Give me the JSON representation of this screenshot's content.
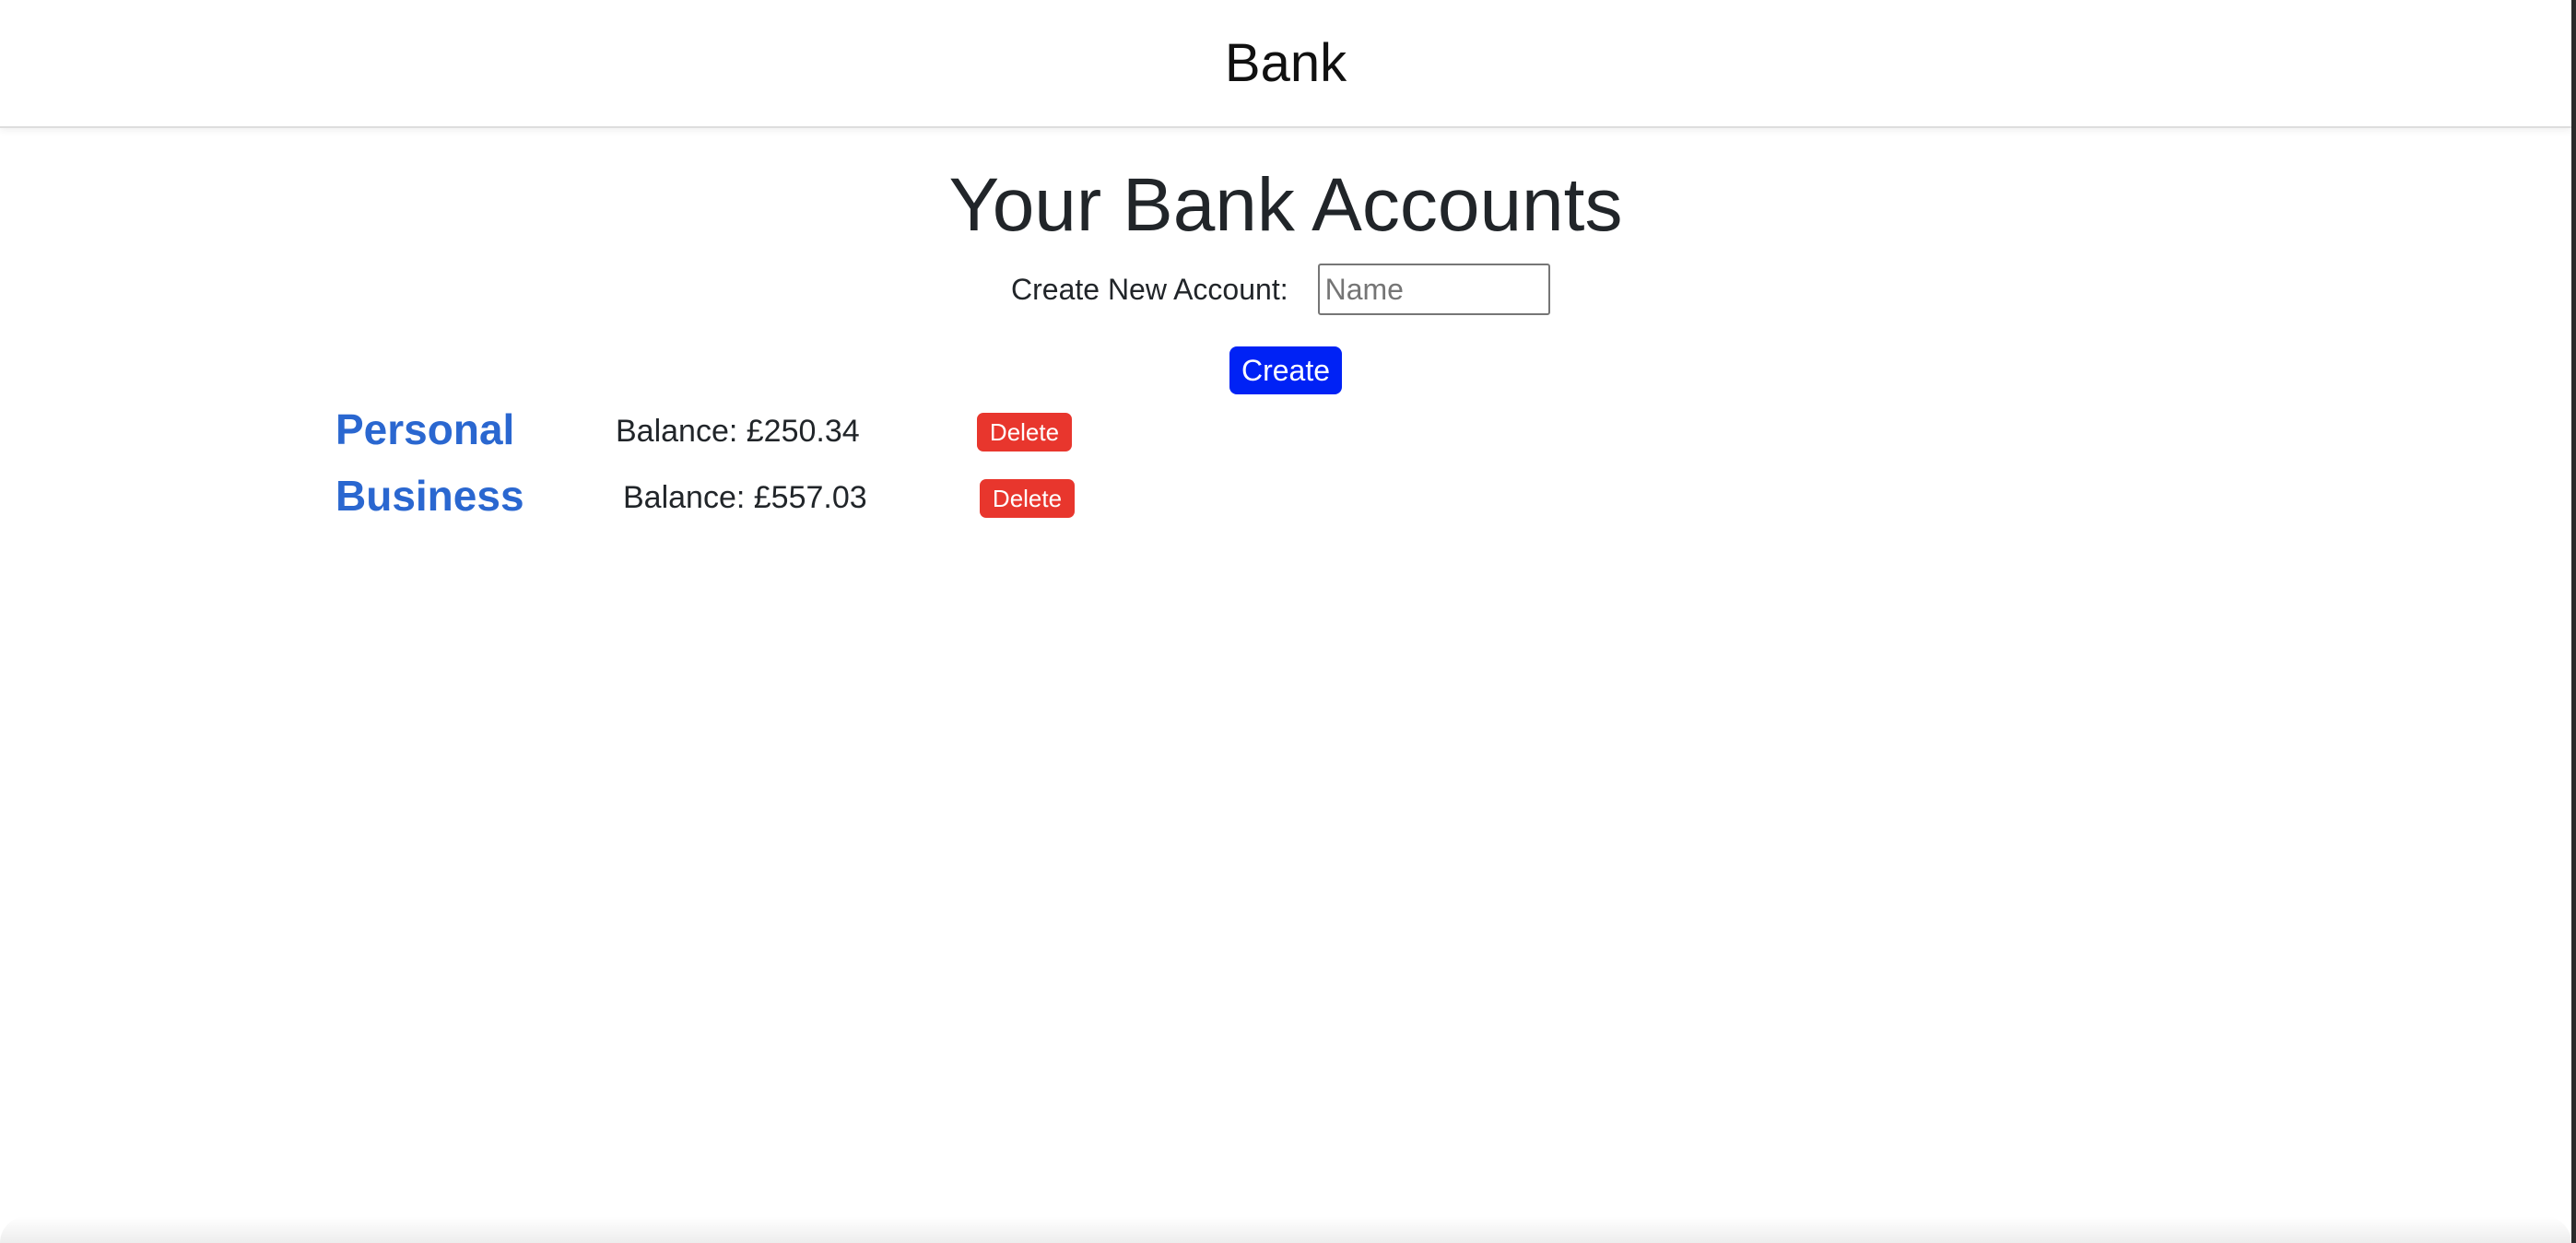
{
  "navbar": {
    "brand": "Bank"
  },
  "main": {
    "title": "Your Bank Accounts",
    "create": {
      "label": "Create New Account:",
      "input_value": "",
      "input_placeholder": "Name",
      "button_label": "Create"
    },
    "accounts": [
      {
        "name": "Personal",
        "balance_text": "Balance: £250.34",
        "delete_label": "Delete"
      },
      {
        "name": "Business",
        "balance_text": "Balance: £557.03",
        "delete_label": "Delete"
      }
    ]
  },
  "colors": {
    "link": "#2a67d0",
    "create_button": "#0022f5",
    "delete_button": "#e8362d"
  }
}
